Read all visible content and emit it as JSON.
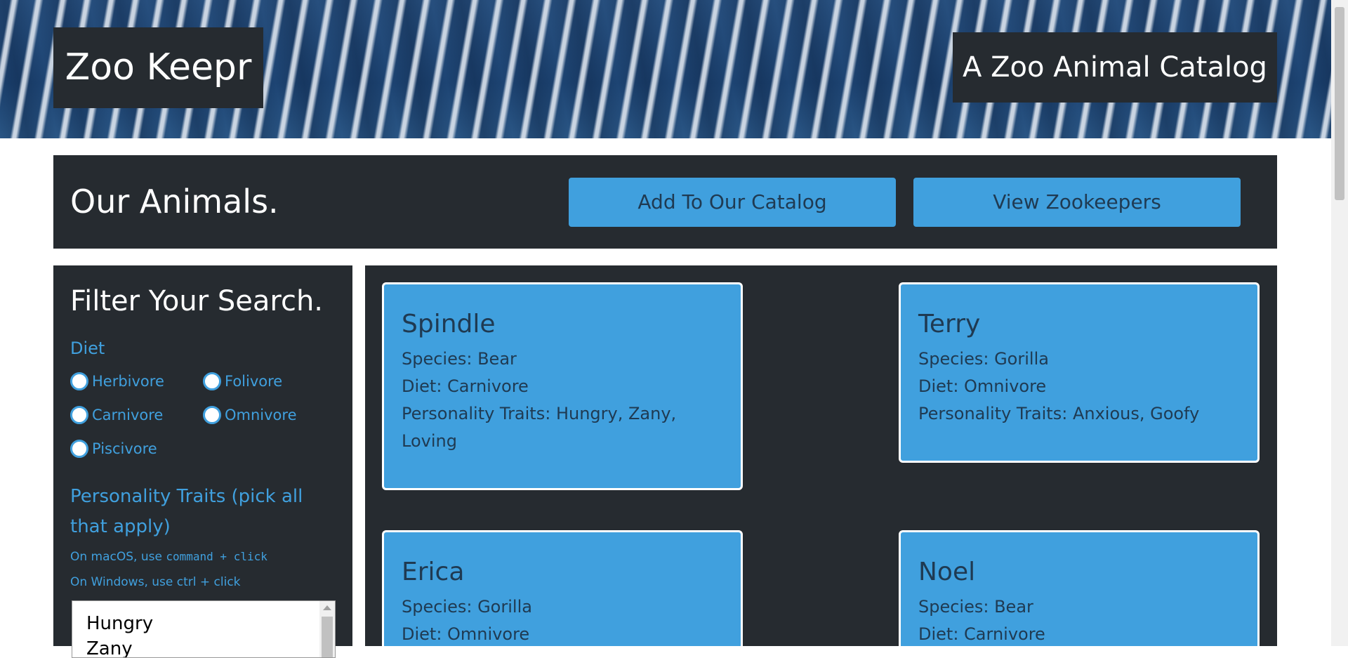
{
  "header": {
    "brand": "Zoo Keepr",
    "tagline": "A Zoo Animal Catalog"
  },
  "animals_bar": {
    "title": "Our Animals.",
    "add_label": "Add To Our Catalog",
    "view_label": "View Zookeepers"
  },
  "filter": {
    "title": "Filter Your Search.",
    "diet_label": "Diet",
    "diets": [
      "Herbivore",
      "Folivore",
      "Carnivore",
      "Omnivore",
      "Piscivore"
    ],
    "traits_label": "Personality Traits (pick all that apply)",
    "mac_hint_prefix": "On macOS, use",
    "mac_hint_keys": "command + click",
    "win_hint": "On Windows, use ctrl + click",
    "trait_options": [
      "Hungry",
      "Zany"
    ]
  },
  "animals": [
    {
      "name": "Spindle",
      "species": "Species: Bear",
      "diet": "Diet: Carnivore",
      "traits": "Personality Traits: Hungry, Zany, Loving"
    },
    {
      "name": "Terry",
      "species": "Species: Gorilla",
      "diet": "Diet: Omnivore",
      "traits": "Personality Traits: Anxious, Goofy"
    },
    {
      "name": "Erica",
      "species": "Species: Gorilla",
      "diet": "Diet: Omnivore",
      "traits": ""
    },
    {
      "name": "Noel",
      "species": "Species: Bear",
      "diet": "Diet: Carnivore",
      "traits": ""
    }
  ],
  "colors": {
    "accent": "#40a0de",
    "panel": "#262b30",
    "card_text": "#1f3a52"
  }
}
